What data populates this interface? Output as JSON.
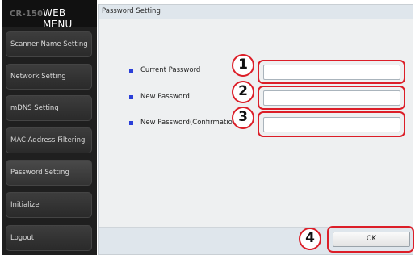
{
  "brand": {
    "model": "CR-150",
    "title": "WEB MENU"
  },
  "sidebar": {
    "items": [
      {
        "label": "Scanner Name Setting"
      },
      {
        "label": "Network Setting"
      },
      {
        "label": "mDNS Setting"
      },
      {
        "label": "MAC Address Filtering"
      },
      {
        "label": "Password Setting"
      },
      {
        "label": "Initialize"
      },
      {
        "label": "Logout"
      }
    ],
    "active": "Password Setting"
  },
  "main": {
    "title": "Password Setting",
    "fields": [
      {
        "label": "Current Password",
        "value": "",
        "callout": "1"
      },
      {
        "label": "New Password",
        "value": "",
        "callout": "2"
      },
      {
        "label": "New Password(Confirmation)",
        "value": "",
        "callout": "3"
      }
    ],
    "ok_label": "OK",
    "ok_callout": "4"
  },
  "colors": {
    "callout_red": "#dc1e28",
    "bullet_blue": "#2a3fd8",
    "sidebar_bg": "#1f1f1f",
    "panel_bg": "#eef0f1"
  }
}
